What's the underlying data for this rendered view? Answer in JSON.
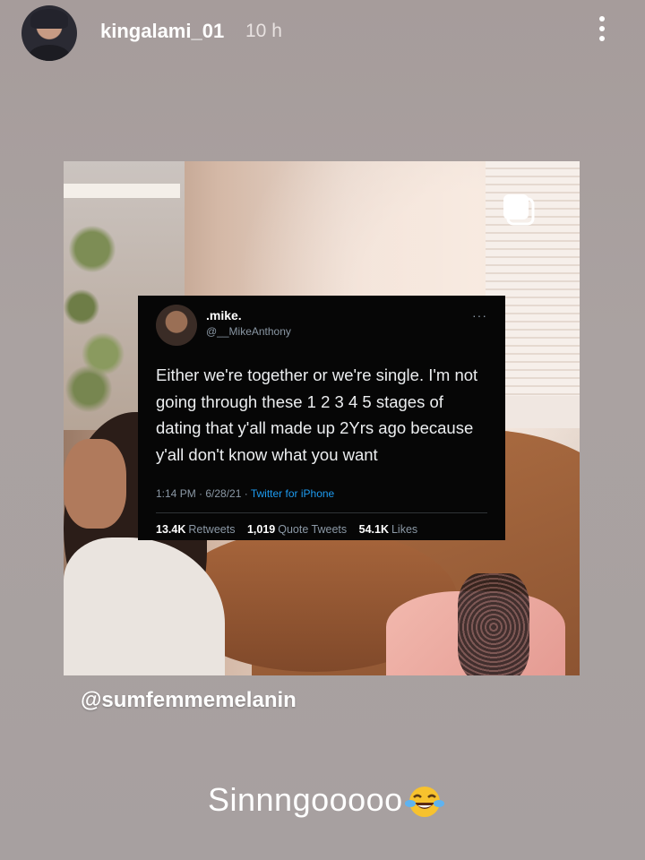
{
  "story_header": {
    "username": "kingalami_01",
    "time_ago": "10 h",
    "avatar_icon": "profile-avatar",
    "more_icon": "vertical-ellipsis-icon"
  },
  "tweet": {
    "display_name": ".mike.",
    "handle": "@__MikeAnthony",
    "menu_icon": "···",
    "text": "Either we're together or we're single. I'm not going through these 1 2 3 4 5 stages of dating that y'all made up 2Yrs ago because y'all don't know what you want",
    "timestamp": "1:14 PM · 6/28/21 · ",
    "source": "Twitter for iPhone",
    "retweets_count": "13.4K",
    "retweets_label": "Retweets",
    "quote_count": "1,019",
    "quote_label": "Quote Tweets",
    "likes_count": "54.1K",
    "likes_label": "Likes"
  },
  "mention_sticker": "@sumfemmemelanin",
  "caption": {
    "text": "Sinnngooooo",
    "emoji_icon": "face-with-tears-of-joy-icon"
  },
  "colors": {
    "background": "#a9a1a0",
    "tweet_bg": "#060606",
    "link_blue": "#1d9bf0"
  }
}
